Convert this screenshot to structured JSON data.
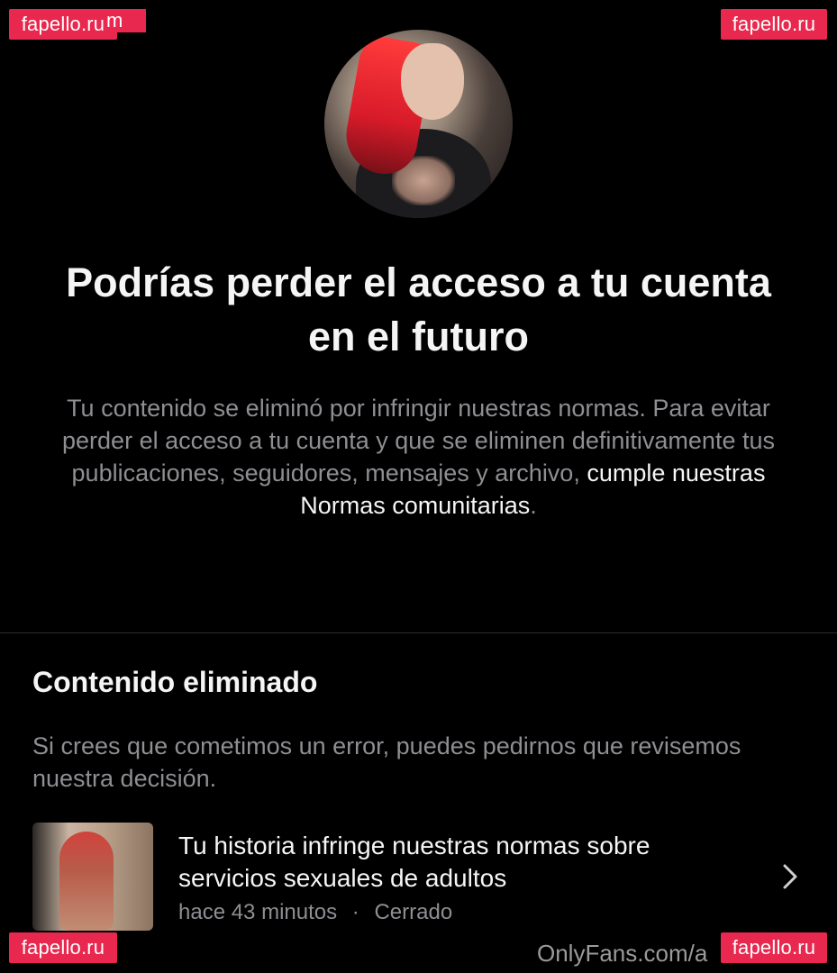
{
  "watermarks": {
    "top_left": "fapello.ru",
    "top_left_extra": "m",
    "top_right": "fapello.ru",
    "bottom_left": "fapello.ru",
    "bottom_right": "fapello.ru",
    "footer": "OnlyFans.com/a"
  },
  "header": {
    "title": "Podrías perder el acceso a tu cuenta en el futuro",
    "description_main": "Tu contenido se eliminó por infringir nuestras normas. Para evitar perder el acceso a tu cuenta y que se eliminen definitivamente tus publicaciones, seguidores, mensajes y archivo, ",
    "description_link": "cumple nuestras Normas comunitarias",
    "description_end": "."
  },
  "removed_section": {
    "title": "Contenido eliminado",
    "description": "Si crees que cometimos un error, puedes pedirnos que revisemos nuestra decisión.",
    "items": [
      {
        "title": "Tu historia infringe nuestras normas sobre servicios sexuales de adultos",
        "time": "hace 43 minutos",
        "separator": "·",
        "status": "Cerrado",
        "icon": "chevron-right-icon"
      }
    ]
  }
}
